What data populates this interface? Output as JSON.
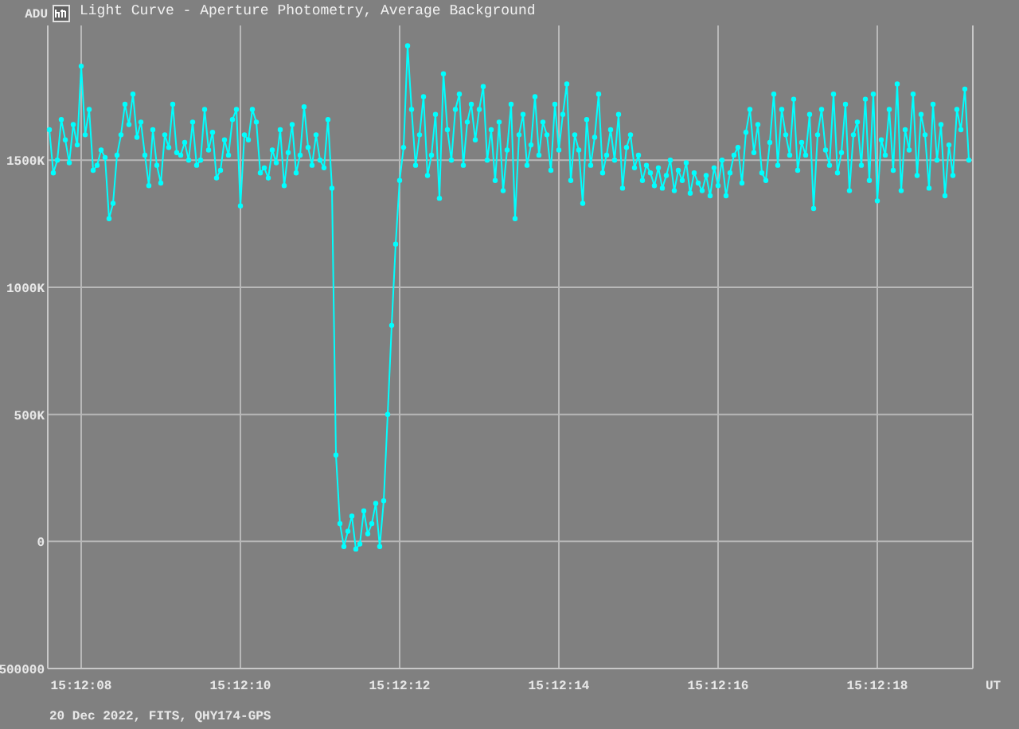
{
  "chart_data": {
    "type": "line",
    "title": "Light Curve - Aperture Photometry, Average Background",
    "ylabel": "ADU",
    "xlabel": "UT",
    "grid": true,
    "xlim": [
      54727.58,
      54739.2
    ],
    "ylim": [
      -500000,
      2030000
    ],
    "xticks": [
      {
        "value": 54728,
        "label": "15:12:08"
      },
      {
        "value": 54730,
        "label": "15:12:10"
      },
      {
        "value": 54732,
        "label": "15:12:12"
      },
      {
        "value": 54734,
        "label": "15:12:14"
      },
      {
        "value": 54736,
        "label": "15:12:16"
      },
      {
        "value": 54738,
        "label": "15:12:18"
      }
    ],
    "yticks": [
      {
        "value": -500000,
        "label": "500000"
      },
      {
        "value": 0,
        "label": "0"
      },
      {
        "value": 500000,
        "label": "500K"
      },
      {
        "value": 1000000,
        "label": "1000K"
      },
      {
        "value": 1500000,
        "label": "1500K"
      }
    ],
    "x": [
      54727.6,
      54727.65,
      54727.7,
      54727.75,
      54727.8,
      54727.85,
      54727.9,
      54727.95,
      54728,
      54728.05,
      54728.1,
      54728.15,
      54728.2,
      54728.25,
      54728.3,
      54728.35,
      54728.4,
      54728.45,
      54728.5,
      54728.55,
      54728.6,
      54728.65,
      54728.7,
      54728.75,
      54728.8,
      54728.85,
      54728.9,
      54728.95,
      54729,
      54729.05,
      54729.1,
      54729.15,
      54729.2,
      54729.25,
      54729.3,
      54729.35,
      54729.4,
      54729.45,
      54729.5,
      54729.55,
      54729.6,
      54729.65,
      54729.7,
      54729.75,
      54729.8,
      54729.85,
      54729.9,
      54729.95,
      54730,
      54730.05,
      54730.1,
      54730.15,
      54730.2,
      54730.25,
      54730.3,
      54730.35,
      54730.4,
      54730.45,
      54730.5,
      54730.55,
      54730.6,
      54730.65,
      54730.7,
      54730.75,
      54730.8,
      54730.85,
      54730.9,
      54730.95,
      54731,
      54731.05,
      54731.1,
      54731.15,
      54731.2,
      54731.25,
      54731.3,
      54731.35,
      54731.4,
      54731.45,
      54731.5,
      54731.55,
      54731.6,
      54731.65,
      54731.7,
      54731.75,
      54731.8,
      54731.85,
      54731.9,
      54731.95,
      54732,
      54732.05,
      54732.1,
      54732.15,
      54732.2,
      54732.25,
      54732.3,
      54732.35,
      54732.4,
      54732.45,
      54732.5,
      54732.55,
      54732.6,
      54732.65,
      54732.7,
      54732.75,
      54732.8,
      54732.85,
      54732.9,
      54732.95,
      54733,
      54733.05,
      54733.1,
      54733.15,
      54733.2,
      54733.25,
      54733.3,
      54733.35,
      54733.4,
      54733.45,
      54733.5,
      54733.55,
      54733.6,
      54733.65,
      54733.7,
      54733.75,
      54733.8,
      54733.85,
      54733.9,
      54733.95,
      54734,
      54734.05,
      54734.1,
      54734.15,
      54734.2,
      54734.25,
      54734.3,
      54734.35,
      54734.4,
      54734.45,
      54734.5,
      54734.55,
      54734.6,
      54734.65,
      54734.7,
      54734.75,
      54734.8,
      54734.85,
      54734.9,
      54734.95,
      54735,
      54735.05,
      54735.1,
      54735.15,
      54735.2,
      54735.25,
      54735.3,
      54735.35,
      54735.4,
      54735.45,
      54735.5,
      54735.55,
      54735.6,
      54735.65,
      54735.7,
      54735.75,
      54735.8,
      54735.85,
      54735.9,
      54735.95,
      54736,
      54736.05,
      54736.1,
      54736.15,
      54736.2,
      54736.25,
      54736.3,
      54736.35,
      54736.4,
      54736.45,
      54736.5,
      54736.55,
      54736.6,
      54736.65,
      54736.7,
      54736.75,
      54736.8,
      54736.85,
      54736.9,
      54736.95,
      54737,
      54737.05,
      54737.1,
      54737.15,
      54737.2,
      54737.25,
      54737.3,
      54737.35,
      54737.4,
      54737.45,
      54737.5,
      54737.55,
      54737.6,
      54737.65,
      54737.7,
      54737.75,
      54737.8,
      54737.85,
      54737.9,
      54737.95,
      54738,
      54738.05,
      54738.1,
      54738.15,
      54738.2,
      54738.25,
      54738.3,
      54738.35,
      54738.4,
      54738.45,
      54738.5,
      54738.55,
      54738.6,
      54738.65,
      54738.7,
      54738.75,
      54738.8,
      54738.85,
      54738.9,
      54738.95,
      54739,
      54739.05,
      54739.1,
      54739.15
    ],
    "series": [
      {
        "color": "#00ffff",
        "marker": "circle",
        "values": [
          1620000,
          1450000,
          1500000,
          1660000,
          1580000,
          1490000,
          1640000,
          1560000,
          1870000,
          1600000,
          1700000,
          1460000,
          1480000,
          1540000,
          1510000,
          1270000,
          1330000,
          1520000,
          1600000,
          1720000,
          1640000,
          1760000,
          1590000,
          1650000,
          1520000,
          1400000,
          1620000,
          1480000,
          1410000,
          1600000,
          1550000,
          1720000,
          1530000,
          1520000,
          1570000,
          1500000,
          1650000,
          1480000,
          1500000,
          1700000,
          1540000,
          1610000,
          1430000,
          1460000,
          1580000,
          1520000,
          1660000,
          1700000,
          1320000,
          1600000,
          1580000,
          1700000,
          1650000,
          1450000,
          1470000,
          1430000,
          1540000,
          1490000,
          1620000,
          1400000,
          1530000,
          1640000,
          1450000,
          1520000,
          1710000,
          1550000,
          1480000,
          1600000,
          1500000,
          1470000,
          1660000,
          1390000,
          340000,
          70000,
          -20000,
          40000,
          100000,
          -30000,
          -10000,
          120000,
          30000,
          70000,
          150000,
          -20000,
          160000,
          500000,
          850000,
          1170000,
          1420000,
          1550000,
          1950000,
          1700000,
          1480000,
          1600000,
          1750000,
          1440000,
          1520000,
          1680000,
          1350000,
          1840000,
          1620000,
          1500000,
          1700000,
          1760000,
          1480000,
          1650000,
          1720000,
          1580000,
          1700000,
          1790000,
          1500000,
          1620000,
          1420000,
          1650000,
          1380000,
          1540000,
          1720000,
          1270000,
          1600000,
          1680000,
          1480000,
          1560000,
          1750000,
          1520000,
          1650000,
          1600000,
          1460000,
          1720000,
          1540000,
          1680000,
          1800000,
          1420000,
          1600000,
          1540000,
          1330000,
          1660000,
          1480000,
          1590000,
          1760000,
          1450000,
          1520000,
          1620000,
          1500000,
          1680000,
          1390000,
          1550000,
          1600000,
          1470000,
          1520000,
          1420000,
          1480000,
          1450000,
          1400000,
          1470000,
          1390000,
          1440000,
          1500000,
          1380000,
          1460000,
          1420000,
          1490000,
          1370000,
          1450000,
          1410000,
          1380000,
          1440000,
          1360000,
          1470000,
          1400000,
          1500000,
          1360000,
          1450000,
          1520000,
          1550000,
          1410000,
          1610000,
          1700000,
          1530000,
          1640000,
          1450000,
          1420000,
          1570000,
          1760000,
          1480000,
          1700000,
          1600000,
          1520000,
          1740000,
          1460000,
          1570000,
          1520000,
          1680000,
          1310000,
          1600000,
          1700000,
          1540000,
          1480000,
          1760000,
          1450000,
          1530000,
          1720000,
          1380000,
          1600000,
          1650000,
          1480000,
          1740000,
          1420000,
          1760000,
          1340000,
          1580000,
          1520000,
          1700000,
          1460000,
          1800000,
          1380000,
          1620000,
          1540000,
          1760000,
          1440000,
          1680000,
          1600000,
          1390000,
          1720000,
          1500000,
          1640000,
          1360000,
          1560000,
          1440000,
          1700000,
          1620000,
          1780000,
          1500000
        ]
      }
    ]
  },
  "caption": "20 Dec 2022, FITS, QHY174-GPS"
}
